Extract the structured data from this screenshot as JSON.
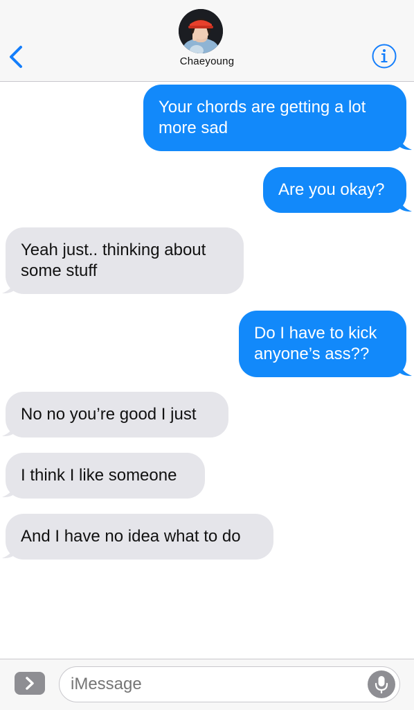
{
  "header": {
    "contact_name": "Chaeyoung",
    "back_icon": "chevron-left-icon",
    "info_icon": "info-circle-icon",
    "avatar": "contact-photo"
  },
  "messages": [
    {
      "direction": "sent",
      "lines": [
        "Your chords are getting a lot",
        "more sad"
      ]
    },
    {
      "direction": "sent",
      "lines": [
        "Are you okay?"
      ]
    },
    {
      "direction": "received",
      "lines": [
        "Yeah just.. thinking about",
        "some stuff"
      ]
    },
    {
      "direction": "sent",
      "lines": [
        "Do I have to kick",
        "anyone’s ass??"
      ]
    },
    {
      "direction": "received",
      "lines": [
        "No no you’re good I just"
      ]
    },
    {
      "direction": "received",
      "lines": [
        "I think I like someone"
      ]
    },
    {
      "direction": "received",
      "lines": [
        "And I have no idea what to do"
      ]
    }
  ],
  "composer": {
    "placeholder": "iMessage",
    "apps_icon": "chevron-right-icon",
    "mic_icon": "microphone-icon"
  },
  "colors": {
    "sent_bubble": "#1289fa",
    "received_bubble": "#e5e5ea",
    "accent": "#147efb"
  }
}
